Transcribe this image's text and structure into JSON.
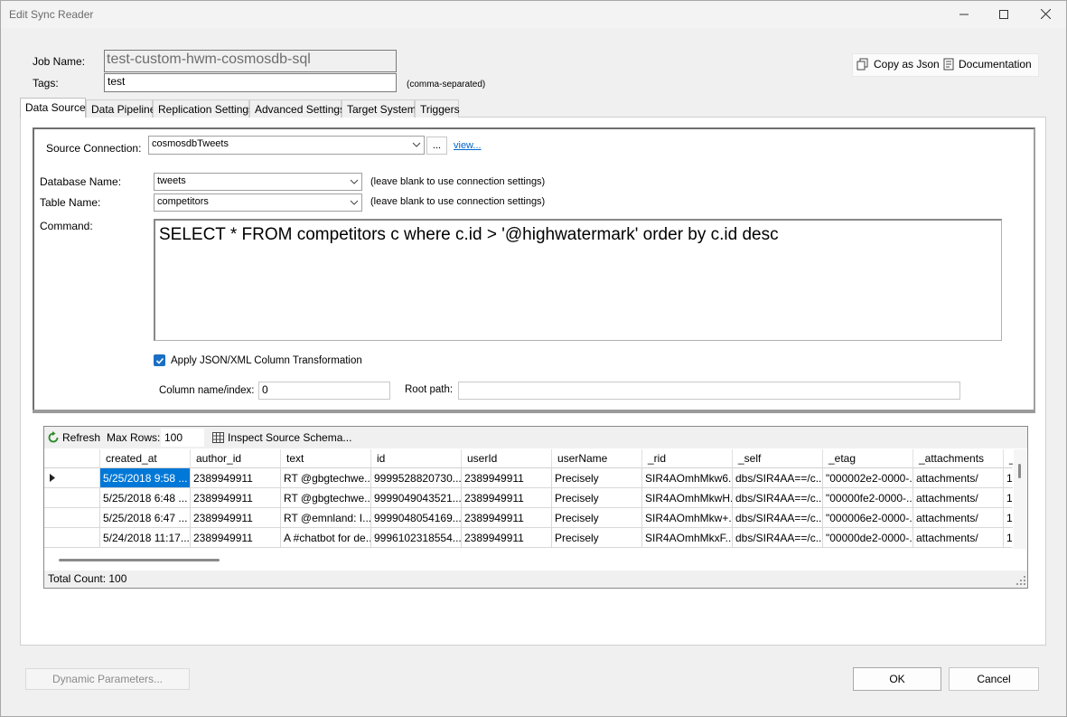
{
  "window": {
    "title": "Edit Sync Reader"
  },
  "job": {
    "name_label": "Job Name:",
    "name_value": "test-custom-hwm-cosmosdb-sql",
    "tags_label": "Tags:",
    "tags_value": "test",
    "tags_hint": "(comma-separated)"
  },
  "toolbar": {
    "copy_json_label": "Copy as Json",
    "documentation_label": "Documentation"
  },
  "tabs": [
    {
      "label": "Data Source",
      "active": true
    },
    {
      "label": "Data Pipeline"
    },
    {
      "label": "Replication Settings"
    },
    {
      "label": "Advanced Settings"
    },
    {
      "label": "Target System"
    },
    {
      "label": "Triggers"
    }
  ],
  "source": {
    "connection_label": "Source Connection:",
    "connection_value": "cosmosdbTweets",
    "browse_label": "...",
    "view_label": "view...",
    "database_label": "Database Name:",
    "database_value": "tweets",
    "database_hint": "(leave blank to use connection settings)",
    "table_label": "Table Name:",
    "table_value": "competitors",
    "table_hint": "(leave blank to use connection settings)",
    "command_label": "Command:",
    "command_value": "SELECT * FROM competitors c where c.id > '@highwatermark' order by c.id desc",
    "transform_label": "Apply JSON/XML Column Transformation",
    "transform_checked": true,
    "column_label": "Column name/index:",
    "column_value": "0",
    "root_label": "Root path:",
    "root_value": ""
  },
  "grid": {
    "refresh_label": "Refresh",
    "max_rows_label": "Max Rows:",
    "max_rows_value": "100",
    "inspect_label": "Inspect Source Schema...",
    "columns": [
      "created_at",
      "author_id",
      "text",
      "id",
      "userId",
      "userName",
      "_rid",
      "_self",
      "_etag",
      "_attachments",
      "_"
    ],
    "rows": [
      [
        "5/25/2018 9:58 ...",
        "2389949911",
        "RT @gbgtechwe...",
        "9999528820730...",
        "2389949911",
        "Precisely",
        "SIR4AOmhMkw6...",
        "dbs/SIR4AA==/c...",
        "\"000002e2-0000-...",
        "attachments/",
        "1"
      ],
      [
        "5/25/2018 6:48 ...",
        "2389949911",
        "RT @gbgtechwe...",
        "9999049043521...",
        "2389949911",
        "Precisely",
        "SIR4AOmhMkwH...",
        "dbs/SIR4AA==/c...",
        "\"00000fe2-0000-...",
        "attachments/",
        "1"
      ],
      [
        "5/25/2018 6:47 ...",
        "2389949911",
        "RT @emnland: I...",
        "9999048054169...",
        "2389949911",
        "Precisely",
        "SIR4AOmhMkw+...",
        "dbs/SIR4AA==/c...",
        "\"000006e2-0000-...",
        "attachments/",
        "1"
      ],
      [
        "5/24/2018 11:17...",
        "2389949911",
        "A #chatbot for de...",
        "9996102318554...",
        "2389949911",
        "Precisely",
        "SIR4AOmhMkxF...",
        "dbs/SIR4AA==/c...",
        "\"00000de2-0000-...",
        "attachments/",
        "1"
      ]
    ],
    "total_label": "Total Count: 100"
  },
  "footer": {
    "dynamic_label": "Dynamic Parameters...",
    "ok_label": "OK",
    "cancel_label": "Cancel"
  },
  "colors": {
    "selection": "#0078d7",
    "link": "#0066cc",
    "accent": "#1a6ec4"
  }
}
